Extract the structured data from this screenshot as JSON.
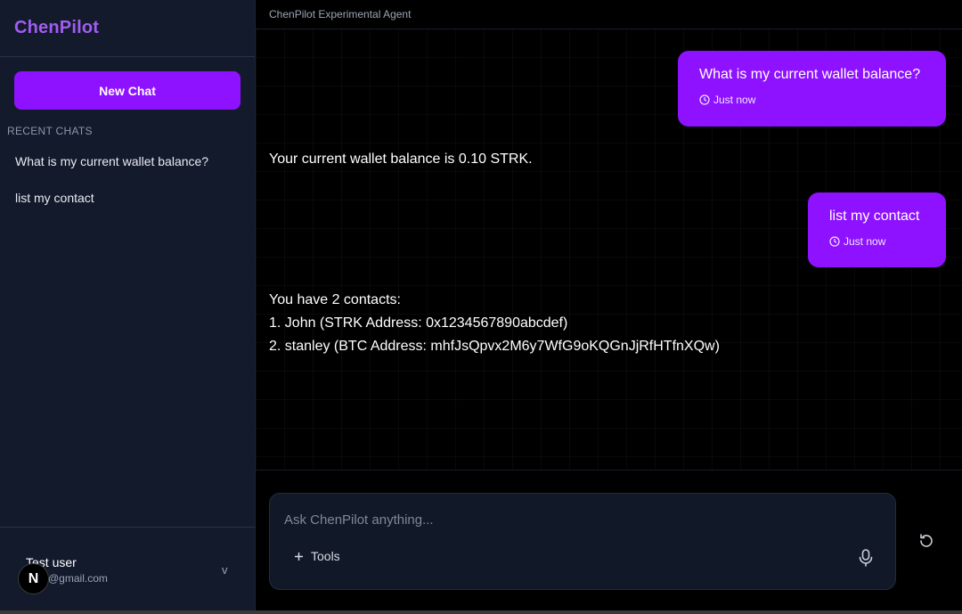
{
  "sidebar": {
    "brand": "ChenPilot",
    "new_chat_label": "New Chat",
    "recent_heading": "RECENT CHATS",
    "recent_chats": [
      "What is my current wallet balance?",
      "list my contact"
    ],
    "user": {
      "name": "Test user",
      "email": "@gmail.com",
      "chevron": "v",
      "avatar_letter": "N"
    }
  },
  "header": {
    "title": "ChenPilot Experimental Agent"
  },
  "messages": [
    {
      "role": "user",
      "text": "What is my current wallet balance?",
      "time": "Just now"
    },
    {
      "role": "assistant",
      "lines": [
        "Your current wallet balance is 0.10 STRK."
      ]
    },
    {
      "role": "user",
      "text": "list my contact",
      "time": "Just now"
    },
    {
      "role": "assistant",
      "lines": [
        "You have 2 contacts:",
        "1. John (STRK Address: 0x1234567890abcdef)",
        "2. stanley (BTC Address: mhfJsQpvx2M6y7WfG9oKQGnJjRfHTfnXQw)"
      ]
    }
  ],
  "composer": {
    "placeholder": "Ask ChenPilot anything...",
    "tools_label": "Tools",
    "tools_icon": "plus-icon",
    "mic_icon": "microphone-icon",
    "reset_icon": "refresh-icon"
  },
  "colors": {
    "accent": "#8e12ff",
    "brand_text": "#a25cf2",
    "sidebar_bg": "#121a2b",
    "composer_bg": "#111827"
  }
}
